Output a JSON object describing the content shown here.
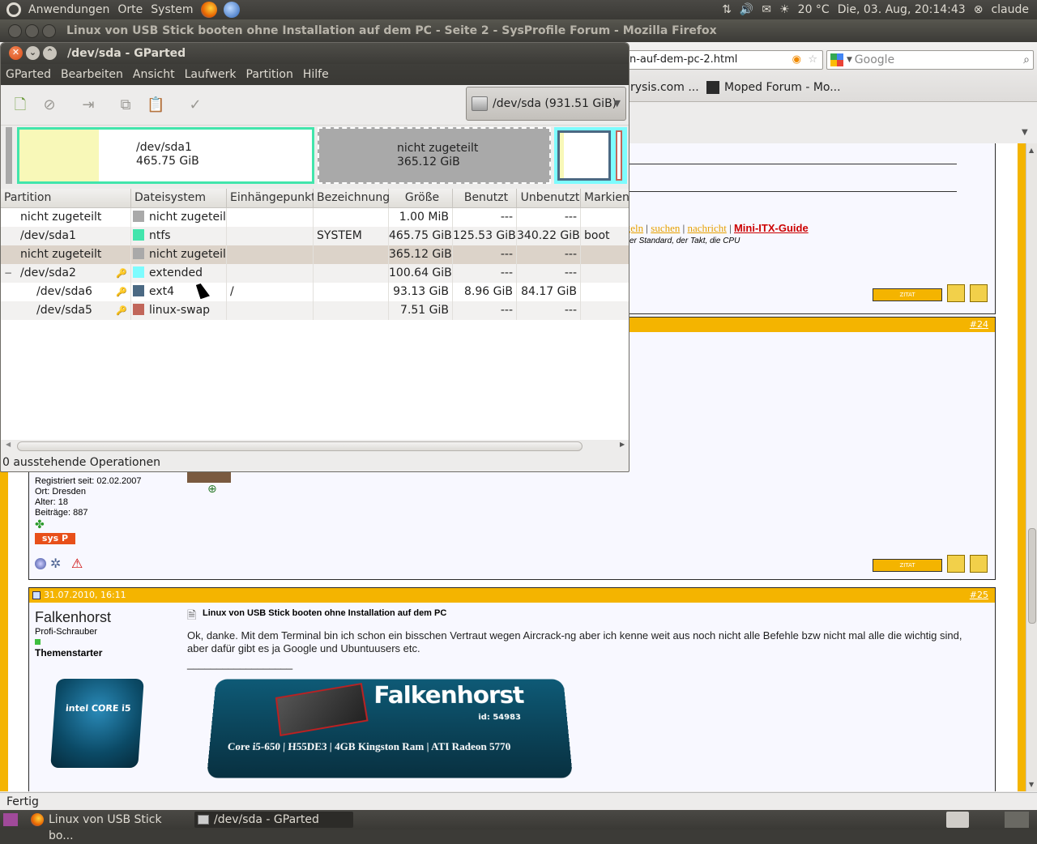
{
  "top_panel": {
    "menus": [
      "Anwendungen",
      "Orte",
      "System"
    ],
    "temperature": "20 °C",
    "datetime": "Die, 03. Aug, 20:14:43",
    "user": "claude"
  },
  "firefox": {
    "title": "Linux von USB Stick booten ohne Installation auf dem PC - Seite 2 - SysProfile Forum - Mozilla Firefox",
    "url_fragment": "n-auf-dem-pc-2.html",
    "search_placeholder": "Google",
    "bookmarks": [
      "rysis.com ...",
      "Moped Forum - Mo..."
    ],
    "status": "Fertig",
    "page": {
      "nav_links": [
        "egeln",
        "suchen",
        "nachricht",
        "Mini-ITX-Guide"
      ],
      "nav_sep": "|",
      "tagline": "| der Standard, der Takt, die CPU",
      "zitat_label": "ZITAT",
      "post24": {
        "num": "#24"
      },
      "user_info": {
        "registered": "Registriert seit: 02.02.2007",
        "location": "Ort: Dresden",
        "age": "Alter: 18",
        "posts": "Beiträge: 887",
        "badge": "sys P"
      },
      "post25": {
        "date": "31.07.2010, 16:11",
        "num": "#25",
        "author": "Falkenhorst",
        "rank": "Profi-Schrauber",
        "role": "Themenstarter",
        "subject": "Linux von USB Stick booten ohne Installation auf dem PC",
        "body": "Ok, danke. Mit dem Terminal bin ich schon ein bisschen Vertraut wegen Aircrack-ng aber ich kenne weit aus noch nicht alle Befehle bzw nicht mal alle die wichtig sind, aber dafür gibt es ja Google und Ubuntuusers etc.",
        "separator": "__________________",
        "banner_name": "Falkenhorst",
        "banner_id": "id: 54983",
        "banner_specs": "Core i5-650 | H55DE3 | 4GB Kingston Ram | ATI Radeon 5770",
        "cpu_badge": "intel CORE i5"
      }
    }
  },
  "gparted": {
    "title": "/dev/sda - GParted",
    "menu": [
      "GParted",
      "Bearbeiten",
      "Ansicht",
      "Laufwerk",
      "Partition",
      "Hilfe"
    ],
    "device": "/dev/sda  (931.51 GiB)",
    "diskmap": [
      {
        "name": "/dev/sda1",
        "size": "465.75 GiB"
      },
      {
        "name": "nicht zugeteilt",
        "size": "365.12 GiB"
      }
    ],
    "columns": [
      "Partition",
      "Dateisystem",
      "Einhängepunkt",
      "Bezeichnung",
      "Größe",
      "Benutzt",
      "Unbenutzt",
      "Markien"
    ],
    "rows": [
      {
        "partition": "nicht zugeteilt",
        "fs": "nicht zugeteilt",
        "fs_color": "#a9a9a9",
        "mount": "",
        "label": "",
        "size": "1.00 MiB",
        "used": "---",
        "unused": "---",
        "flags": ""
      },
      {
        "partition": "/dev/sda1",
        "fs": "ntfs",
        "fs_color": "#42e5ac",
        "mount": "",
        "label": "SYSTEM",
        "size": "465.75 GiB",
        "used": "125.53 GiB",
        "unused": "340.22 GiB",
        "flags": "boot"
      },
      {
        "partition": "nicht zugeteilt",
        "fs": "nicht zugeteilt",
        "fs_color": "#a9a9a9",
        "mount": "",
        "label": "",
        "size": "365.12 GiB",
        "used": "---",
        "unused": "---",
        "flags": ""
      },
      {
        "partition": "/dev/sda2",
        "fs": "extended",
        "fs_color": "#7dfcfe",
        "mount": "",
        "label": "",
        "size": "100.64 GiB",
        "used": "---",
        "unused": "---",
        "flags": ""
      },
      {
        "partition": "/dev/sda6",
        "fs": "ext4",
        "fs_color": "#4b6983",
        "mount": "/",
        "label": "",
        "size": "93.13 GiB",
        "used": "8.96 GiB",
        "unused": "84.17 GiB",
        "flags": ""
      },
      {
        "partition": "/dev/sda5",
        "fs": "linux-swap",
        "fs_color": "#c1665a",
        "mount": "",
        "label": "",
        "size": "7.51 GiB",
        "used": "---",
        "unused": "---",
        "flags": ""
      }
    ],
    "status": "0 ausstehende Operationen"
  },
  "taskbar": {
    "tasks": [
      "Linux von USB Stick bo...",
      "/dev/sda - GParted"
    ]
  }
}
